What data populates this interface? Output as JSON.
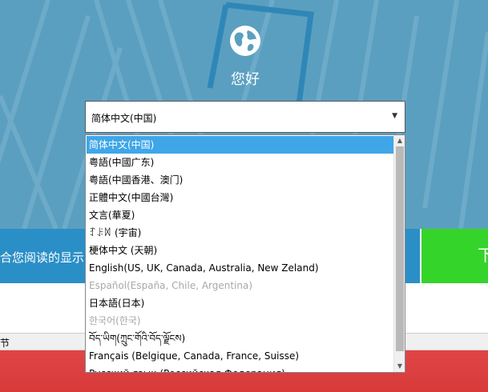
{
  "hero": {
    "greeting": "您好",
    "globe_icon": "globe-icon"
  },
  "band": {
    "text": "合您阅读的显示",
    "next_label": "下"
  },
  "status": {
    "text": "节"
  },
  "language_select": {
    "selected_value": "简体中文(中国)",
    "arrow_icon": "dropdown-arrow-icon"
  },
  "options": [
    {
      "label": "简体中文(中国)",
      "state": "selected"
    },
    {
      "label": "粤語(中國广东)",
      "state": "normal"
    },
    {
      "label": "粤語(中國香港、澳门)",
      "state": "normal"
    },
    {
      "label": "正體中文(中國台灣)",
      "state": "normal"
    },
    {
      "label": "文言(華夏)",
      "state": "normal"
    },
    {
      "label": "ꆈꌠꉙ (宇宙)",
      "state": "normal"
    },
    {
      "label": "梗体中文 (天朝)",
      "state": "normal"
    },
    {
      "label": "English(US, UK, Canada, Australia, New Zeland)",
      "state": "normal"
    },
    {
      "label": "Español(España, Chile, Argentina)",
      "state": "disabled"
    },
    {
      "label": "日本語(日本)",
      "state": "normal"
    },
    {
      "label": "한국어(한국)",
      "state": "disabled"
    },
    {
      "label": "བོད་ཡིག(ཀྲུང་གོའི་བོད་ལྗོངས)",
      "state": "normal"
    },
    {
      "label": "Français (Belgique, Canada, France, Suisse)",
      "state": "normal"
    },
    {
      "label": "Русский язык (Российская Федерация)",
      "state": "normal"
    }
  ],
  "colors": {
    "hero_bg": "#5b9fc0",
    "band_bg": "#2b8fc7",
    "next_button": "#35d42b",
    "selected_option": "#3fa6e8",
    "bottom_red": "#d83a3a"
  }
}
